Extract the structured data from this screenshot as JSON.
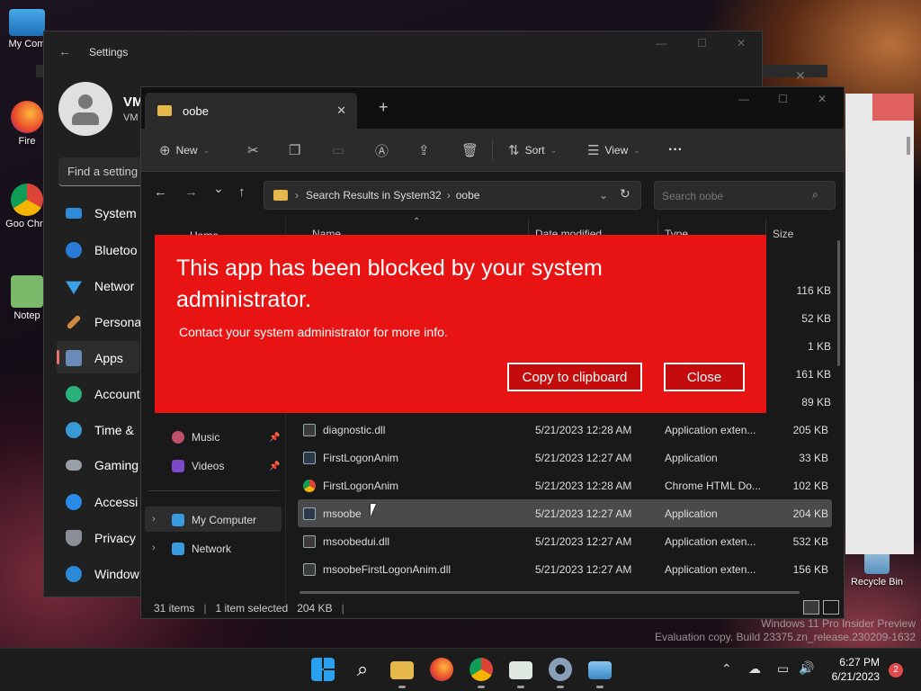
{
  "desktop": {
    "icons": [
      {
        "label": "My Com"
      },
      {
        "label": "Fire"
      },
      {
        "label": "Goo Chro"
      },
      {
        "label": "Notep"
      },
      {
        "label": "Recycle Bin"
      }
    ],
    "watermark": {
      "line1": "Windows 11 Pro Insider Preview",
      "line2": "Evaluation copy. Build 23375.zn_release.230209-1632"
    }
  },
  "settings": {
    "title": "Settings",
    "user": {
      "name": "VM",
      "sub": "VM"
    },
    "search_placeholder": "Find a setting",
    "nav": [
      {
        "label": "System",
        "icon": "monitor-icon",
        "color": "#2f8ad8"
      },
      {
        "label": "Bluetoo",
        "icon": "bluetooth-icon",
        "color": "#2a7ad8"
      },
      {
        "label": "Networ",
        "icon": "wifi-icon",
        "color": "#3aa0e8"
      },
      {
        "label": "Persona",
        "icon": "brush-icon",
        "color": "#d08a40"
      },
      {
        "label": "Apps",
        "icon": "apps-icon",
        "color": "#6a8ab8"
      },
      {
        "label": "Account",
        "icon": "person-icon",
        "color": "#2ab07a"
      },
      {
        "label": "Time &",
        "icon": "clock-icon",
        "color": "#3a9ad8"
      },
      {
        "label": "Gaming",
        "icon": "controller-icon",
        "color": "#9aa0a8"
      },
      {
        "label": "Accessi",
        "icon": "accessibility-icon",
        "color": "#2a8ae8"
      },
      {
        "label": "Privacy",
        "icon": "shield-icon",
        "color": "#8a8f98"
      },
      {
        "label": "Window",
        "icon": "update-icon",
        "color": "#2a8ad8"
      }
    ]
  },
  "explorer": {
    "tab_title": "oobe",
    "toolbar": {
      "new": "New",
      "sort": "Sort",
      "view": "View",
      "more": "···"
    },
    "breadcrumb": {
      "part1": "Search Results in System32",
      "part2": "oobe"
    },
    "search_placeholder": "Search oobe",
    "columns": {
      "name": "Name",
      "date": "Date modified",
      "type": "Type",
      "size": "Size"
    },
    "sidebar_top": "Home",
    "quick": [
      {
        "label": "Music"
      },
      {
        "label": "Videos"
      }
    ],
    "tree": [
      {
        "label": "My Computer"
      },
      {
        "label": "Network"
      }
    ],
    "hidden_sizes": [
      "116 KB",
      "52 KB",
      "1 KB",
      "161 KB",
      "89 KB"
    ],
    "rows": [
      {
        "name": "diagnostic.dll",
        "date": "5/21/2023 12:28 AM",
        "type": "Application exten...",
        "size": "205 KB",
        "selected": false
      },
      {
        "name": "FirstLogonAnim",
        "date": "5/21/2023 12:27 AM",
        "type": "Application",
        "size": "33 KB",
        "selected": false
      },
      {
        "name": "FirstLogonAnim",
        "date": "5/21/2023 12:28 AM",
        "type": "Chrome HTML Do...",
        "size": "102 KB",
        "selected": false
      },
      {
        "name": "msoobe",
        "date": "5/21/2023 12:27 AM",
        "type": "Application",
        "size": "204 KB",
        "selected": true
      },
      {
        "name": "msoobedui.dll",
        "date": "5/21/2023 12:27 AM",
        "type": "Application exten...",
        "size": "532 KB",
        "selected": false
      },
      {
        "name": "msoobeFirstLogonAnim.dll",
        "date": "5/21/2023 12:27 AM",
        "type": "Application exten...",
        "size": "156 KB",
        "selected": false
      }
    ],
    "status": {
      "count": "31 items",
      "selected": "1 item selected",
      "size": "204 KB",
      "sep": "|"
    }
  },
  "dialog": {
    "title": "This app has been blocked by your system administrator.",
    "message": "Contact your system administrator for more info.",
    "copy_label": "Copy to clipboard",
    "close_label": "Close"
  },
  "taskbar": {
    "time": "6:27 PM",
    "date": "6/21/2023",
    "notification_count": "2",
    "icons": [
      "windows-start-icon",
      "search-icon",
      "file-explorer-icon",
      "firefox-icon",
      "chrome-icon",
      "notepad-icon",
      "settings-icon",
      "remote-desktop-icon"
    ]
  }
}
